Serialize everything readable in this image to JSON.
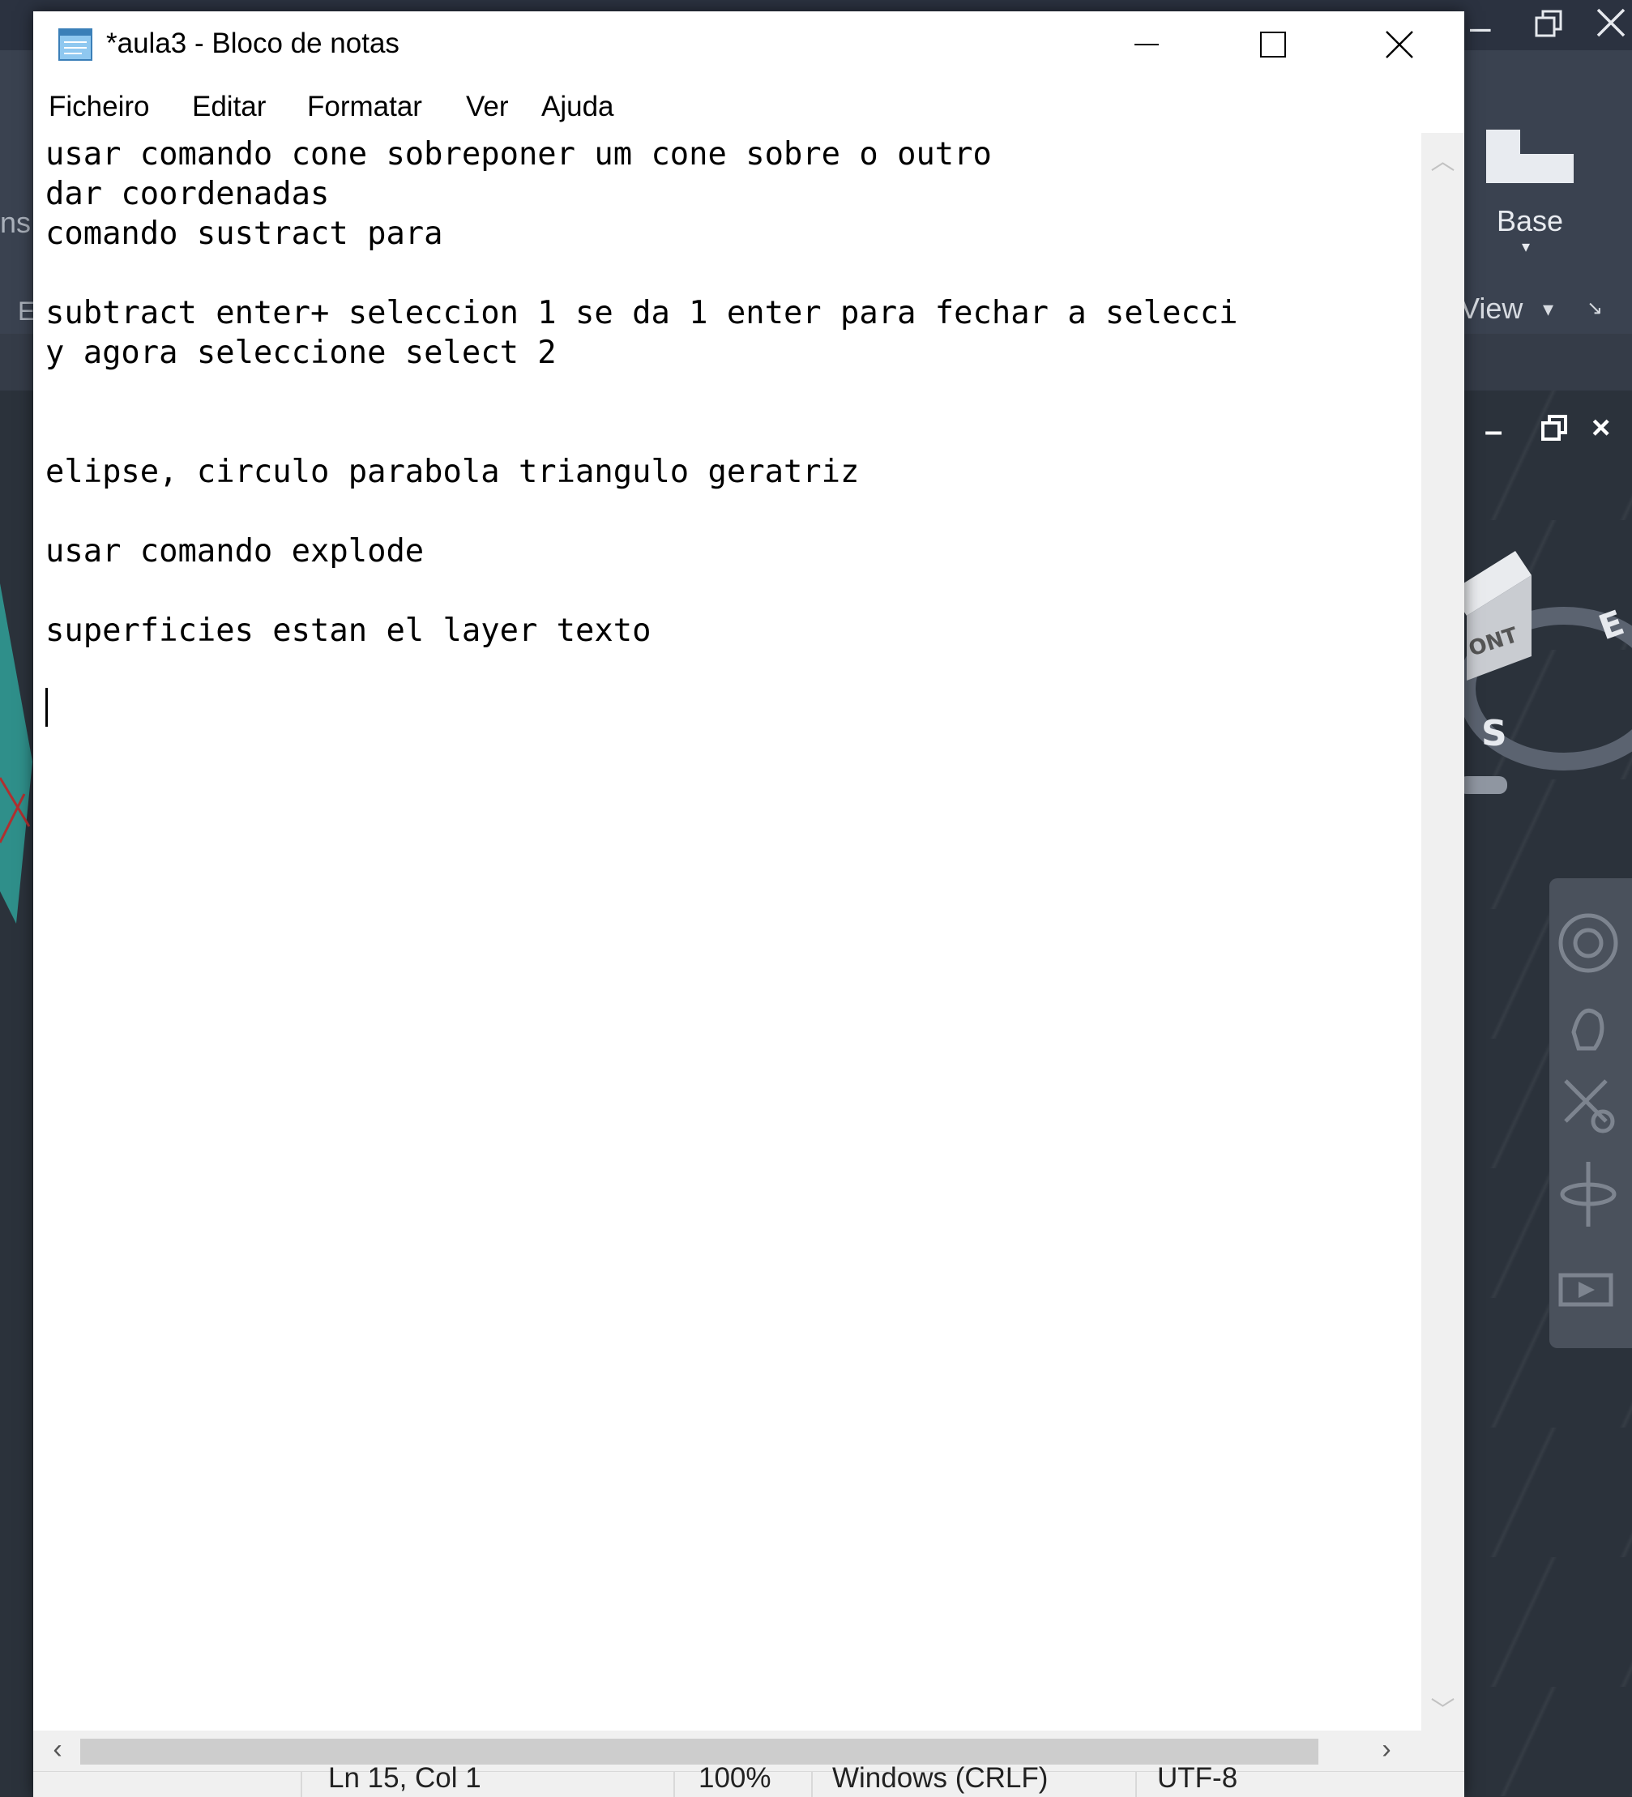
{
  "window": {
    "title": "*aula3 - Bloco de notas",
    "buttons": {
      "minimize": "minimize-icon",
      "maximize": "maximize-icon",
      "close": "close-icon"
    }
  },
  "menu": [
    "Ficheiro",
    "Editar",
    "Formatar",
    "Ver",
    "Ajuda"
  ],
  "editor": {
    "lines": [
      "usar comando cone sobreponer um cone sobre o outro",
      "dar coordenadas",
      "comando sustract para",
      "",
      "subtract enter+ seleccion 1 se da 1 enter para fechar a selecci",
      "y agora seleccione select 2",
      "",
      "",
      "elipse, circulo parabola triangulo geratriz",
      "",
      "usar comando explode",
      "",
      "superficies estan el layer texto"
    ]
  },
  "status": {
    "position": "Ln 15, Col 1",
    "zoom": "100%",
    "line_endings": "Windows (CRLF)",
    "encoding": "UTF-8"
  },
  "background_app": {
    "ribbon_button": "Base",
    "view_label": "View",
    "left_fragment": "ns",
    "left_fragment_2": "E",
    "viewcube": {
      "face": "ONT",
      "east": "E",
      "south": "S"
    }
  },
  "colors": {
    "notepad_bg": "#ffffff",
    "cad_bg": "#2b323b",
    "cad_ribbon": "#3a4250",
    "scrollbar": "#f0f0f0"
  }
}
